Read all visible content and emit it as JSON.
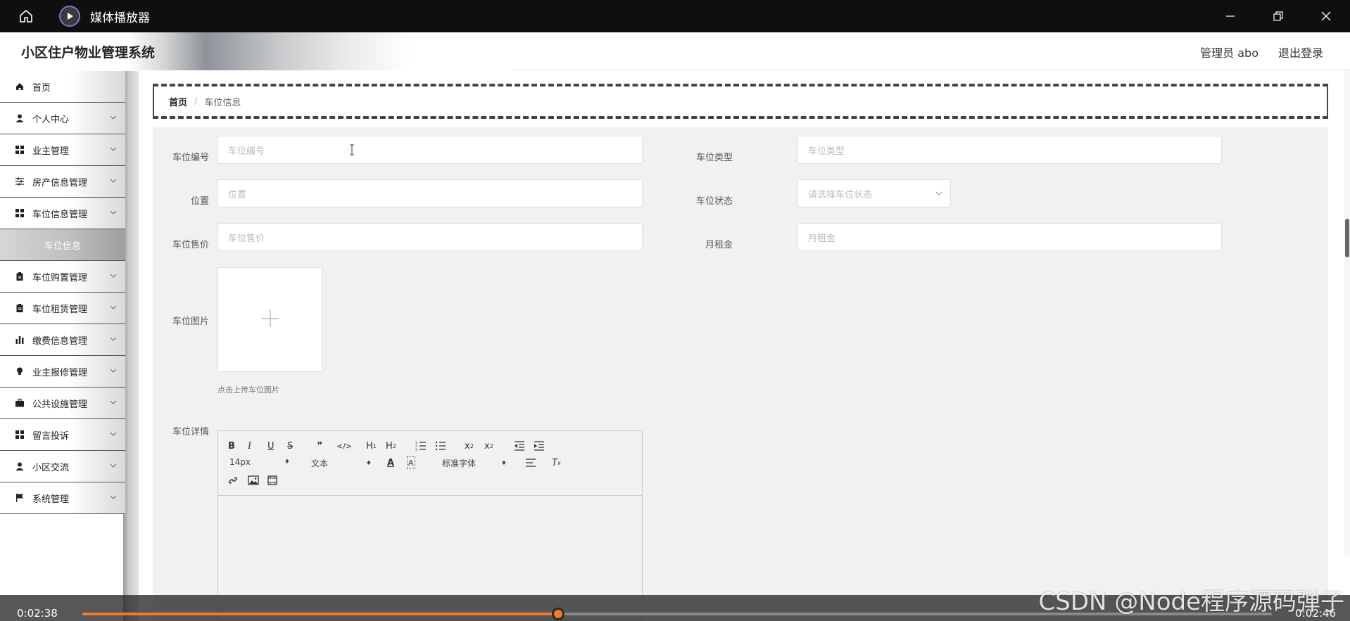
{
  "player": {
    "title": "媒体播放器",
    "time_current": "0:02:38",
    "time_total": "0:02:46",
    "progress": 0.4,
    "accent": "#f07a28",
    "watermark": "CSDN @Node程序源码弹子"
  },
  "header": {
    "brand": "小区住户物业管理系统",
    "user": "管理员 abo",
    "logout": "退出登录"
  },
  "sidebar": {
    "items": [
      {
        "label": "首页",
        "icon": "home-icon",
        "expandable": false
      },
      {
        "label": "个人中心",
        "icon": "user-icon",
        "expandable": true
      },
      {
        "label": "业主管理",
        "icon": "grid-icon",
        "expandable": true
      },
      {
        "label": "房产信息管理",
        "icon": "sliders-icon",
        "expandable": true
      },
      {
        "label": "车位信息管理",
        "icon": "grid-icon",
        "expandable": true
      },
      {
        "label": "车位信息",
        "icon": "",
        "expandable": false,
        "sub": true
      },
      {
        "label": "车位购置管理",
        "icon": "clipboard-icon",
        "expandable": true
      },
      {
        "label": "车位租赁管理",
        "icon": "clipboard-icon",
        "expandable": true
      },
      {
        "label": "缴费信息管理",
        "icon": "bar-chart-icon",
        "expandable": true
      },
      {
        "label": "业主报修管理",
        "icon": "bulb-icon",
        "expandable": true
      },
      {
        "label": "公共设施管理",
        "icon": "briefcase-icon",
        "expandable": true
      },
      {
        "label": "留言投诉",
        "icon": "grid-icon",
        "expandable": true
      },
      {
        "label": "小区交流",
        "icon": "user-icon",
        "expandable": true
      },
      {
        "label": "系统管理",
        "icon": "flag-icon",
        "expandable": true
      }
    ]
  },
  "breadcrumb": {
    "home": "首页",
    "separator": "/",
    "current": "车位信息"
  },
  "form": {
    "code_label": "车位编号",
    "code_placeholder": "车位编号",
    "type_label": "车位类型",
    "type_placeholder": "车位类型",
    "location_label": "位置",
    "location_placeholder": "位置",
    "status_label": "车位状态",
    "status_placeholder": "请选择车位状态",
    "price_label": "车位售价",
    "price_placeholder": "车位售价",
    "rent_label": "月租金",
    "rent_placeholder": "月租金",
    "image_label": "车位图片",
    "image_tip": "点击上传车位图片",
    "detail_label": "车位详情"
  },
  "editor": {
    "font_size": "14px",
    "text_style": "文本",
    "font_family": "标准字体"
  }
}
